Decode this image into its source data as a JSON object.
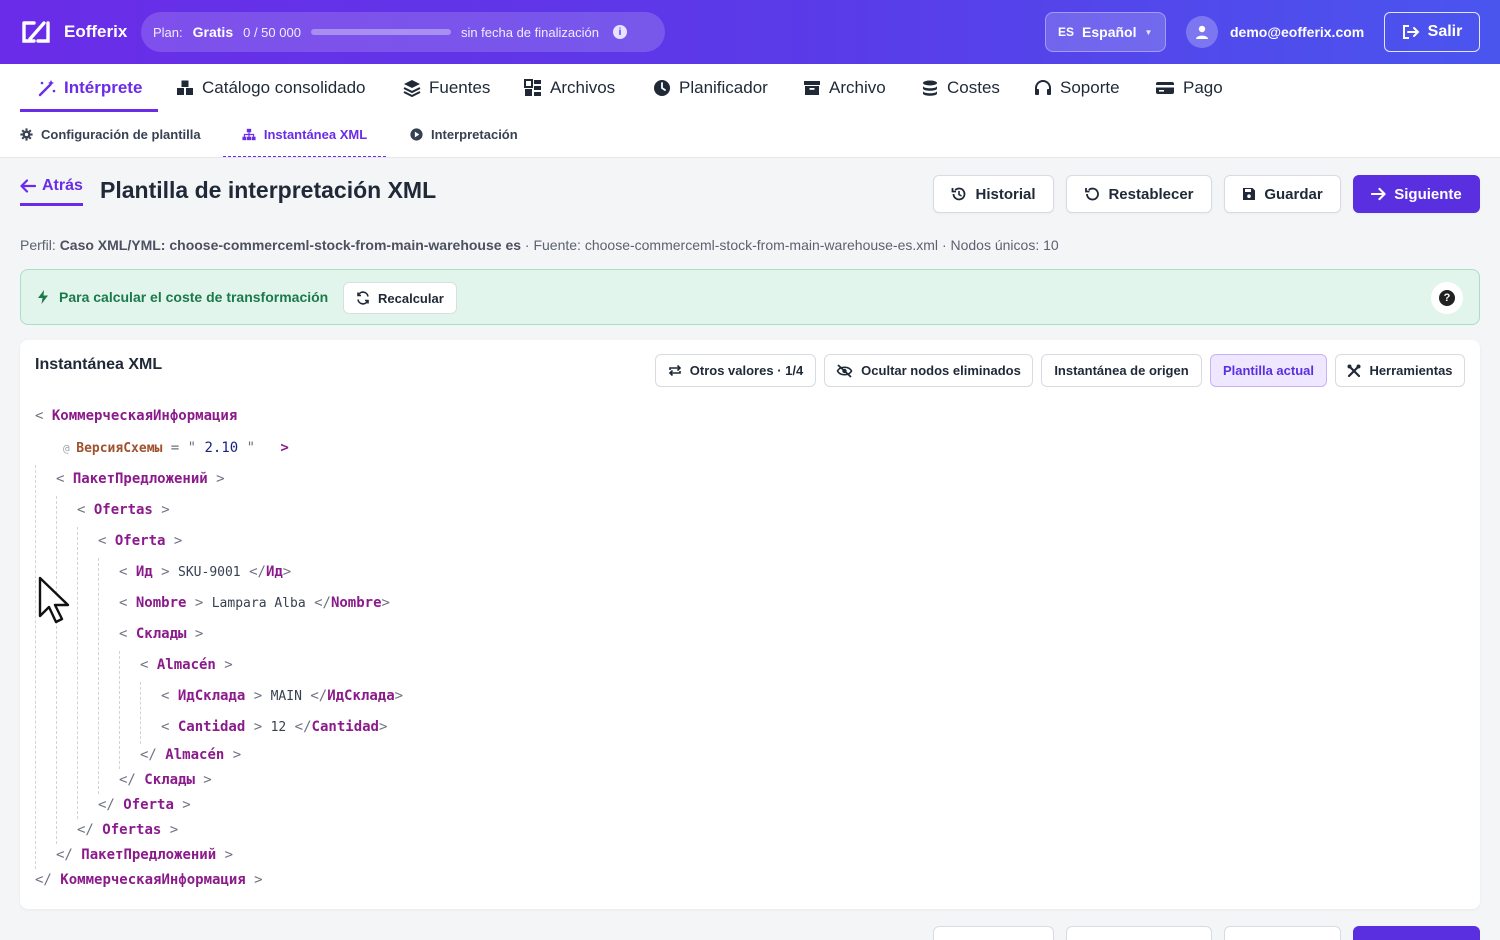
{
  "app": {
    "name": "Eofferix"
  },
  "plan": {
    "label": "Plan:",
    "name": "Gratis",
    "count": "0 / 50 000",
    "usage_fraction": 0.0,
    "end": "sin fecha de finalización"
  },
  "language": {
    "code": "ES",
    "label": "Español"
  },
  "user": {
    "email": "demo@eofferix.com"
  },
  "logout_label": "Salir",
  "nav": [
    {
      "label": "Intérprete",
      "icon": "wand-icon"
    },
    {
      "label": "Catálogo consolidado",
      "icon": "boxes-icon"
    },
    {
      "label": "Fuentes",
      "icon": "layers-icon"
    },
    {
      "label": "Archivos",
      "icon": "grid-icon"
    },
    {
      "label": "Planificador",
      "icon": "clock-icon"
    },
    {
      "label": "Archivo",
      "icon": "archive-icon"
    },
    {
      "label": "Costes",
      "icon": "coins-icon"
    },
    {
      "label": "Soporte",
      "icon": "headset-icon"
    },
    {
      "label": "Pago",
      "icon": "card-icon"
    }
  ],
  "subnav": [
    {
      "label": "Configuración de plantilla",
      "icon": "gear-icon"
    },
    {
      "label": "Instantánea XML",
      "icon": "sitemap-icon"
    },
    {
      "label": "Interpretación",
      "icon": "play-circle-icon"
    }
  ],
  "header": {
    "back_label": "Atrás",
    "title": "Plantilla de interpretación XML",
    "history_label": "Historial",
    "reset_label": "Restablecer",
    "save_label": "Guardar",
    "next_label": "Siguiente"
  },
  "profile": {
    "perfil_label": "Perfil:",
    "perfil_value": "Caso XML/YML: choose-commerceml-stock-from-main-warehouse es",
    "fuente_label": "· Fuente:",
    "fuente_value": "choose-commerceml-stock-from-main-warehouse-es.xml",
    "nodos_label": "· Nodos únicos:",
    "nodos_value": "10"
  },
  "banner": {
    "text": "Para calcular el coste de transformación",
    "recalc_label": "Recalcular",
    "help": "?"
  },
  "snapshot": {
    "title": "Instantánea XML",
    "tools": {
      "other_values": "Otros valores · 1/4",
      "hide_removed": "Ocultar nodos eliminados",
      "source_snapshot": "Instantánea de origen",
      "current_template": "Plantilla actual",
      "tools": "Herramientas"
    },
    "xml": {
      "root": "КоммерческаяИнформация",
      "attr_name": "ВерсияСхемы",
      "attr_value": "2.10",
      "paquete": "ПакетПредложений",
      "ofertas": "Ofertas",
      "oferta": "Oferta",
      "id_tag": "Ид",
      "id_val": "SKU-9001",
      "nombre_tag": "Nombre",
      "nombre_val": "Lampara Alba",
      "sklady": "Склады",
      "almacen": "Almacén",
      "idsklad_tag": "ИдСклада",
      "idsklad_val": "MAIN",
      "cantidad_tag": "Cantidad",
      "cantidad_val": "12"
    }
  },
  "colors": {
    "accent": "#5a2fe0",
    "tag": "#8b1a8b",
    "banner_bg": "#e2f5ec",
    "banner_text": "#1b7a4a"
  }
}
